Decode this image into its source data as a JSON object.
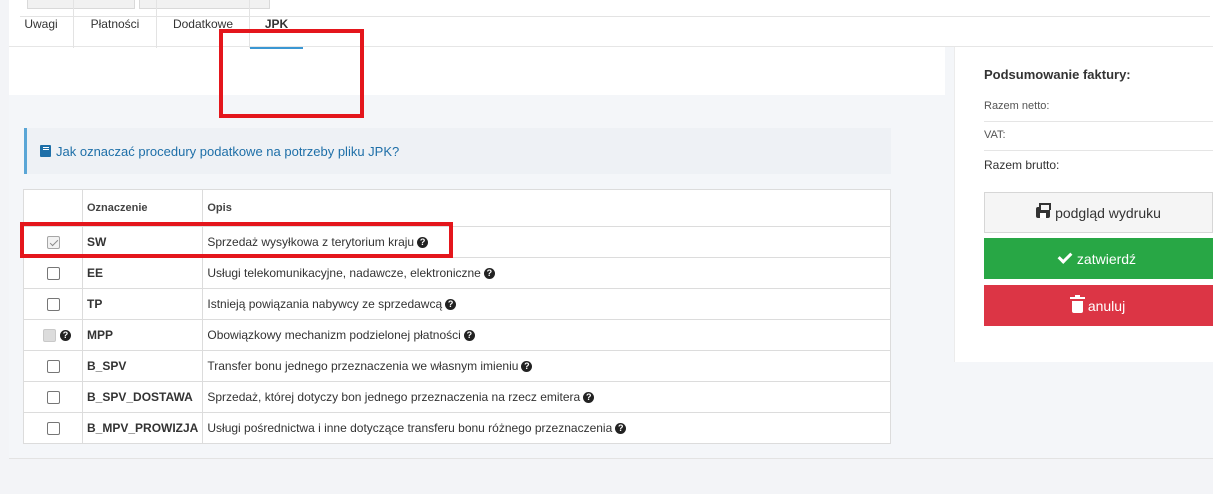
{
  "tabs": [
    {
      "label": "Uwagi"
    },
    {
      "label": "Płatności"
    },
    {
      "label": "Dodatkowe"
    },
    {
      "label": "JPK"
    }
  ],
  "info": {
    "link_text": "Jak oznaczać procedury podatkowe na potrzeby pliku JPK?"
  },
  "table": {
    "headers": {
      "code": "Oznaczenie",
      "desc": "Opis"
    },
    "rows": [
      {
        "code": "SW",
        "desc": "Sprzedaż wysyłkowa z terytorium kraju",
        "checked": true
      },
      {
        "code": "EE",
        "desc": "Usługi telekomunikacyjne, nadawcze, elektroniczne",
        "checked": false
      },
      {
        "code": "TP",
        "desc": "Istnieją powiązania nabywcy ze sprzedawcą",
        "checked": false
      },
      {
        "code": "MPP",
        "desc": "Obowiązkowy mechanizm podzielonej płatności",
        "checked": false
      },
      {
        "code": "B_SPV",
        "desc": "Transfer bonu jednego przeznaczenia we własnym imieniu",
        "checked": false
      },
      {
        "code": "B_SPV_DOSTAWA",
        "desc": "Sprzedaż, której dotyczy bon jednego przeznaczenia na rzecz emitera",
        "checked": false
      },
      {
        "code": "B_MPV_PROWIZJA",
        "desc": "Usługi pośrednictwa i inne dotyczące transferu bonu różnego przeznaczenia",
        "checked": false
      }
    ]
  },
  "help_glyph": "?",
  "summary": {
    "title": "Podsumowanie faktury:",
    "net_label": "Razem netto:",
    "vat_label": "VAT:",
    "gross_label": "Razem brutto:"
  },
  "buttons": {
    "preview": "podgląd wydruku",
    "confirm": "zatwierdź",
    "cancel": "anuluj"
  },
  "colors": {
    "accent": "#3b97d3",
    "confirm": "#28a745",
    "cancel": "#dc3545",
    "highlight": "#e4161c",
    "link": "#1e6fa8"
  }
}
